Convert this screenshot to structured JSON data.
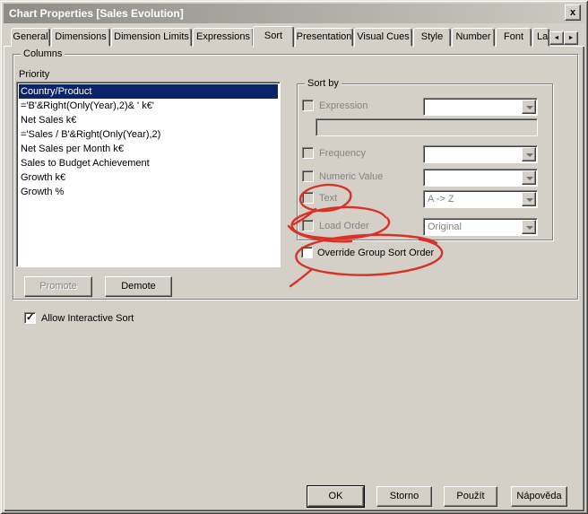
{
  "window": {
    "title": "Chart Properties [Sales Evolution]",
    "close": "x"
  },
  "tabs": [
    {
      "label": "General"
    },
    {
      "label": "Dimensions"
    },
    {
      "label": "Dimension Limits"
    },
    {
      "label": "Expressions"
    },
    {
      "label": "Sort",
      "active": true
    },
    {
      "label": "Presentation"
    },
    {
      "label": "Visual Cues"
    },
    {
      "label": "Style"
    },
    {
      "label": "Number"
    },
    {
      "label": "Font"
    },
    {
      "label": "La"
    }
  ],
  "tab_scroll": {
    "left": "◄",
    "right": "►"
  },
  "columns": {
    "label": "Columns",
    "priority_label": "Priority",
    "items": [
      "Country/Product",
      "='B'&Right(Only(Year),2)& ' k€'",
      "Net Sales k€",
      "='Sales / B'&Right(Only(Year),2)",
      "Net Sales per Month k€",
      "Sales to Budget Achievement",
      "Growth k€",
      "Growth %"
    ],
    "selected_index": 0,
    "promote_label": "Promote",
    "demote_label": "Demote"
  },
  "sort_by": {
    "label": "Sort by",
    "expression": {
      "label": "Expression",
      "combo_value": "",
      "edit_value": ""
    },
    "frequency": {
      "label": "Frequency",
      "combo_value": ""
    },
    "numeric_value": {
      "label": "Numeric Value",
      "combo_value": ""
    },
    "text": {
      "label": "Text",
      "combo_value": "A -> Z"
    },
    "load_order": {
      "label": "Load Order",
      "combo_value": "Original"
    }
  },
  "override_group_sort_order": {
    "label": "Override Group Sort Order",
    "checked": false
  },
  "allow_interactive_sort": {
    "label": "Allow Interactive Sort",
    "checked": true
  },
  "footer_buttons": {
    "ok": "OK",
    "cancel": "Storno",
    "apply": "Použít",
    "help": "Nápověda"
  },
  "colors": {
    "dialog_bg": "#d4d0c8",
    "selection": "#0a246a",
    "annotation_red": "#d92a1f",
    "title_text": "#ffffff"
  },
  "annotations": [
    "red-circle-around-text-checkbox",
    "red-circle-around-load-order-checkbox",
    "red-circle-around-override-group-sort-order-checkbox"
  ]
}
